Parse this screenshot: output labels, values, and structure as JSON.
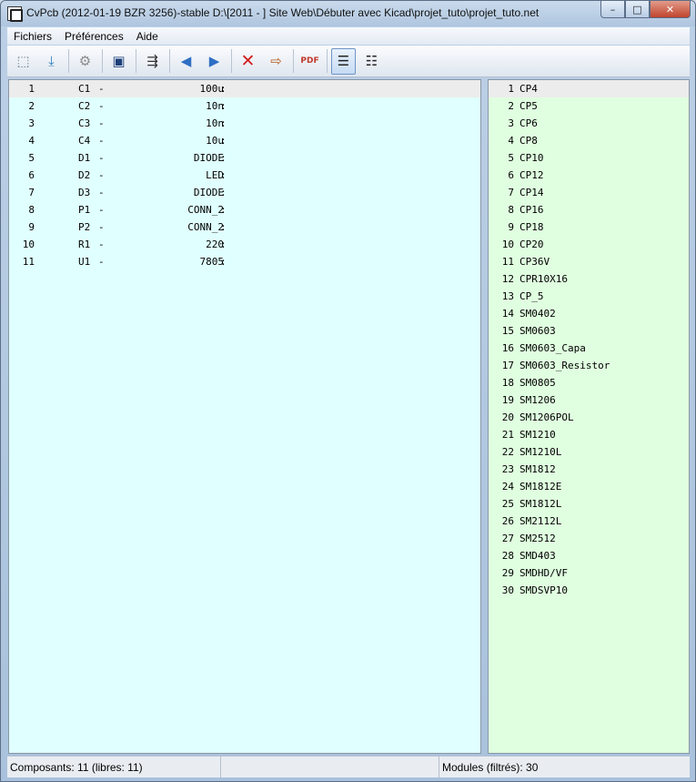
{
  "window": {
    "title": "CvPcb (2012-01-19 BZR 3256)-stable D:\\[2011 - ] Site Web\\Débuter avec Kicad\\projet_tuto\\projet_tuto.net",
    "minimize": "–",
    "maximize": "□",
    "close": "✕"
  },
  "menu": [
    {
      "label": "Fichiers"
    },
    {
      "label": "Préférences"
    },
    {
      "label": "Aide"
    }
  ],
  "toolbar": [
    {
      "icon": "schematic-icon",
      "glyph": "⬚"
    },
    {
      "icon": "save-icon",
      "glyph": "⤓"
    },
    {
      "icon": "settings-gear-icon",
      "glyph": "⚙"
    },
    {
      "icon": "view-footprint-icon",
      "glyph": "▣"
    },
    {
      "icon": "auto-associate-icon",
      "glyph": "⇶"
    },
    {
      "icon": "previous-arrow-icon",
      "glyph": "◀"
    },
    {
      "icon": "next-arrow-icon",
      "glyph": "▶"
    },
    {
      "icon": "delete-associations-icon",
      "glyph": "✕"
    },
    {
      "icon": "export-icon",
      "glyph": "⇨"
    },
    {
      "icon": "pdf-icon",
      "glyph": "PDF"
    },
    {
      "icon": "filter-list-icon",
      "glyph": "☰"
    },
    {
      "icon": "full-list-icon",
      "glyph": "☷"
    }
  ],
  "components": [
    {
      "idx": "1",
      "ref": "C1",
      "value": "100u"
    },
    {
      "idx": "2",
      "ref": "C2",
      "value": "10n"
    },
    {
      "idx": "3",
      "ref": "C3",
      "value": "10n"
    },
    {
      "idx": "4",
      "ref": "C4",
      "value": "10u"
    },
    {
      "idx": "5",
      "ref": "D1",
      "value": "DIODE"
    },
    {
      "idx": "6",
      "ref": "D2",
      "value": "LED"
    },
    {
      "idx": "7",
      "ref": "D3",
      "value": "DIODE"
    },
    {
      "idx": "8",
      "ref": "P1",
      "value": "CONN_2"
    },
    {
      "idx": "9",
      "ref": "P2",
      "value": "CONN_2"
    },
    {
      "idx": "10",
      "ref": "R1",
      "value": "220"
    },
    {
      "idx": "11",
      "ref": "U1",
      "value": "7805"
    }
  ],
  "modules": [
    {
      "idx": "1",
      "name": "CP4"
    },
    {
      "idx": "2",
      "name": "CP5"
    },
    {
      "idx": "3",
      "name": "CP6"
    },
    {
      "idx": "4",
      "name": "CP8"
    },
    {
      "idx": "5",
      "name": "CP10"
    },
    {
      "idx": "6",
      "name": "CP12"
    },
    {
      "idx": "7",
      "name": "CP14"
    },
    {
      "idx": "8",
      "name": "CP16"
    },
    {
      "idx": "9",
      "name": "CP18"
    },
    {
      "idx": "10",
      "name": "CP20"
    },
    {
      "idx": "11",
      "name": "CP36V"
    },
    {
      "idx": "12",
      "name": "CPR10X16"
    },
    {
      "idx": "13",
      "name": "CP_5"
    },
    {
      "idx": "14",
      "name": "SM0402"
    },
    {
      "idx": "15",
      "name": "SM0603"
    },
    {
      "idx": "16",
      "name": "SM0603_Capa"
    },
    {
      "idx": "17",
      "name": "SM0603_Resistor"
    },
    {
      "idx": "18",
      "name": "SM0805"
    },
    {
      "idx": "19",
      "name": "SM1206"
    },
    {
      "idx": "20",
      "name": "SM1206POL"
    },
    {
      "idx": "21",
      "name": "SM1210"
    },
    {
      "idx": "22",
      "name": "SM1210L"
    },
    {
      "idx": "23",
      "name": "SM1812"
    },
    {
      "idx": "24",
      "name": "SM1812E"
    },
    {
      "idx": "25",
      "name": "SM1812L"
    },
    {
      "idx": "26",
      "name": "SM2112L"
    },
    {
      "idx": "27",
      "name": "SM2512"
    },
    {
      "idx": "28",
      "name": "SMD403"
    },
    {
      "idx": "29",
      "name": "SMDHD/VF"
    },
    {
      "idx": "30",
      "name": "SMDSVP10"
    }
  ],
  "status": {
    "components": "Composants: 11 (libres: 11)",
    "middle": "",
    "modules": "Modules (filtrés): 30"
  },
  "colors": {
    "components_bg": "#e0ffff",
    "modules_bg": "#e0ffe0"
  }
}
